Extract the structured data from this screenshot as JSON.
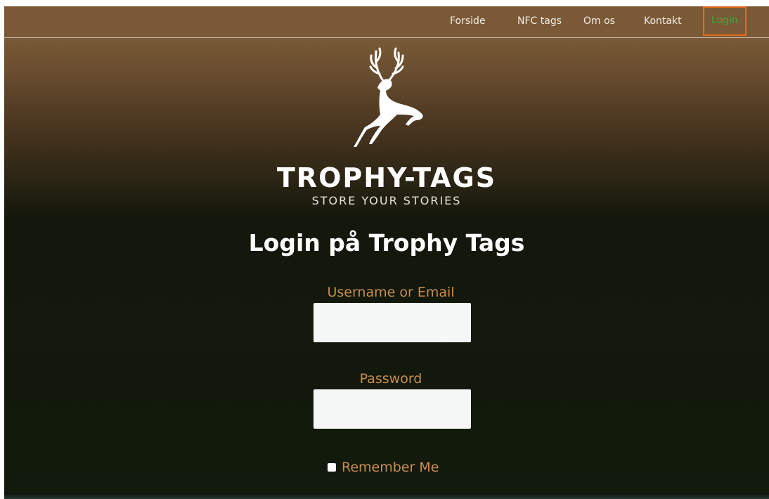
{
  "nav": {
    "items": [
      {
        "label": "Forside"
      },
      {
        "label": "NFC tags"
      },
      {
        "label": "Om os"
      },
      {
        "label": "Kontakt"
      },
      {
        "label": "Login"
      }
    ]
  },
  "brand": {
    "name": "TROPHY-TAGS",
    "tagline": "STORE YOUR STORIES"
  },
  "login": {
    "heading": "Login på Trophy Tags",
    "username_label": "Username or Email",
    "username_value": "",
    "password_label": "Password",
    "password_value": "",
    "remember_label": "Remember Me"
  },
  "colors": {
    "accent_label": "#c88d4e",
    "login_border": "#e06a20",
    "login_text": "#3fa83c",
    "nav_bar": "#7a5a36",
    "page_dark": "#111a0c"
  },
  "icons": {
    "logo": "leaping-deer-icon"
  }
}
